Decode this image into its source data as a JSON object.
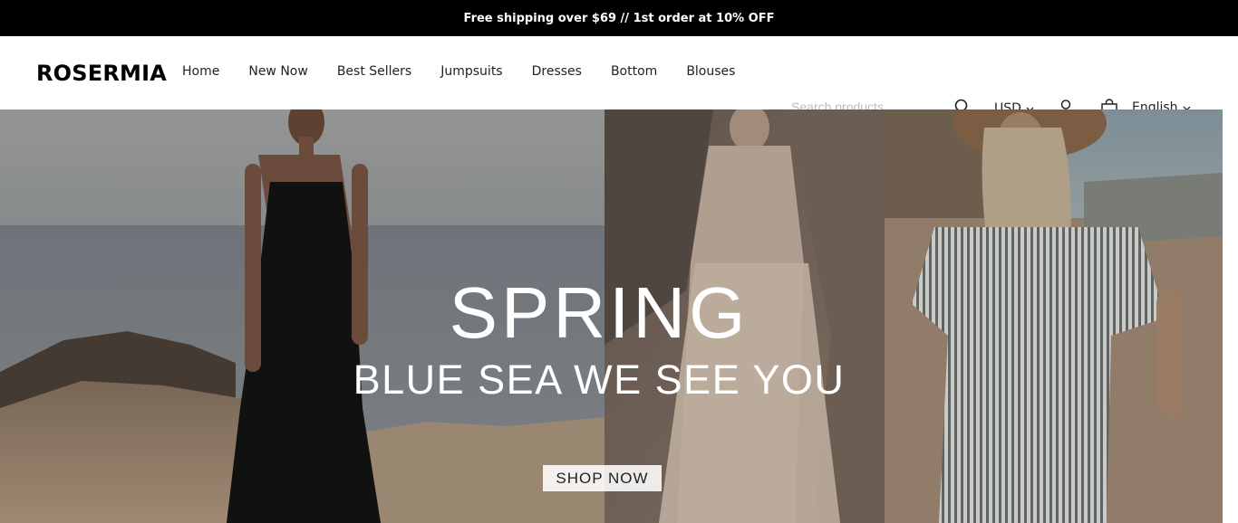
{
  "announcement": "Free shipping over $69 // 1st order at 10% OFF",
  "brand": "ROSERMIA",
  "nav": {
    "items": [
      "Home",
      "New Now",
      "Best Sellers",
      "Jumpsuits",
      "Dresses",
      "Bottom",
      "Blouses"
    ]
  },
  "search": {
    "placeholder": "Search products",
    "icon": "search-icon"
  },
  "currency": "USD",
  "language": "English",
  "icons": {
    "account": "user-icon",
    "cart": "shopping-bag-icon",
    "dropdown": "chevron-down-icon"
  },
  "hero": {
    "title": "SPRING",
    "subtitle": "BLUE SEA WE SEE YOU",
    "button": "SHOP NOW"
  },
  "colors": {
    "announcement_bg": "#000000",
    "text": "#222222",
    "hero_text": "#ffffff"
  }
}
